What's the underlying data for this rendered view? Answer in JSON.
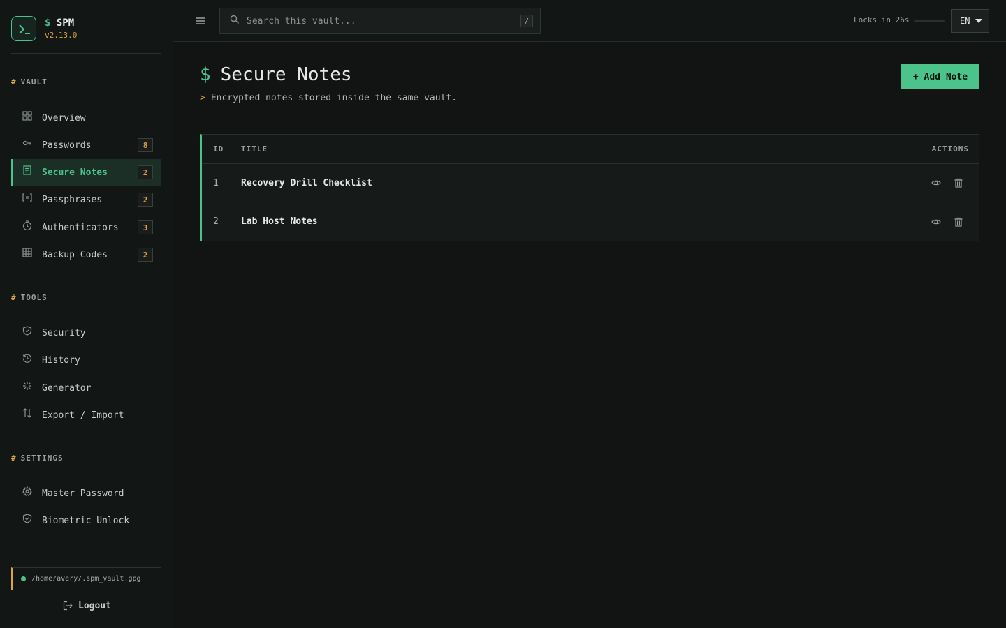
{
  "brand": {
    "prompt": "$",
    "name": "SPM",
    "version": "v2.13.0"
  },
  "sidebar": {
    "sections": [
      {
        "hash": "#",
        "title": "VAULT"
      },
      {
        "hash": "#",
        "title": "TOOLS"
      },
      {
        "hash": "#",
        "title": "SETTINGS"
      }
    ],
    "vault_items": [
      {
        "label": "Overview",
        "icon": "grid-icon"
      },
      {
        "label": "Passwords",
        "icon": "key-icon",
        "badge": "8"
      },
      {
        "label": "Secure Notes",
        "icon": "note-icon",
        "badge": "2",
        "active": true
      },
      {
        "label": "Passphrases",
        "icon": "brackets-icon",
        "badge": "2"
      },
      {
        "label": "Authenticators",
        "icon": "clock-icon",
        "badge": "3"
      },
      {
        "label": "Backup Codes",
        "icon": "table-icon",
        "badge": "2"
      }
    ],
    "tool_items": [
      {
        "label": "Security",
        "icon": "shield-icon"
      },
      {
        "label": "History",
        "icon": "history-icon"
      },
      {
        "label": "Generator",
        "icon": "sparkle-icon"
      },
      {
        "label": "Export / Import",
        "icon": "arrows-updown-icon"
      }
    ],
    "settings_items": [
      {
        "label": "Master Password",
        "icon": "gear-icon"
      },
      {
        "label": "Biometric Unlock",
        "icon": "shield-icon"
      }
    ],
    "vault_path": "/home/avery/.spm_vault.gpg",
    "logout_label": "Logout"
  },
  "topbar": {
    "search_placeholder": "Search this vault...",
    "search_shortcut": "/",
    "lock_label": "Locks in 26s",
    "lock_fraction": 0.0,
    "language": "EN"
  },
  "page": {
    "prompt": "$",
    "title": "Secure Notes",
    "subtitle_prefix": ">",
    "subtitle": "Encrypted notes stored inside the same vault.",
    "add_button": "+ Add Note"
  },
  "table": {
    "columns": [
      "ID",
      "TITLE",
      "ACTIONS"
    ],
    "rows": [
      {
        "id": "1",
        "title": "Recovery Drill Checklist"
      },
      {
        "id": "2",
        "title": "Lab Host Notes"
      }
    ]
  },
  "colors": {
    "accent": "#4cc38a",
    "warning": "#d9a441",
    "background": "#111413"
  }
}
